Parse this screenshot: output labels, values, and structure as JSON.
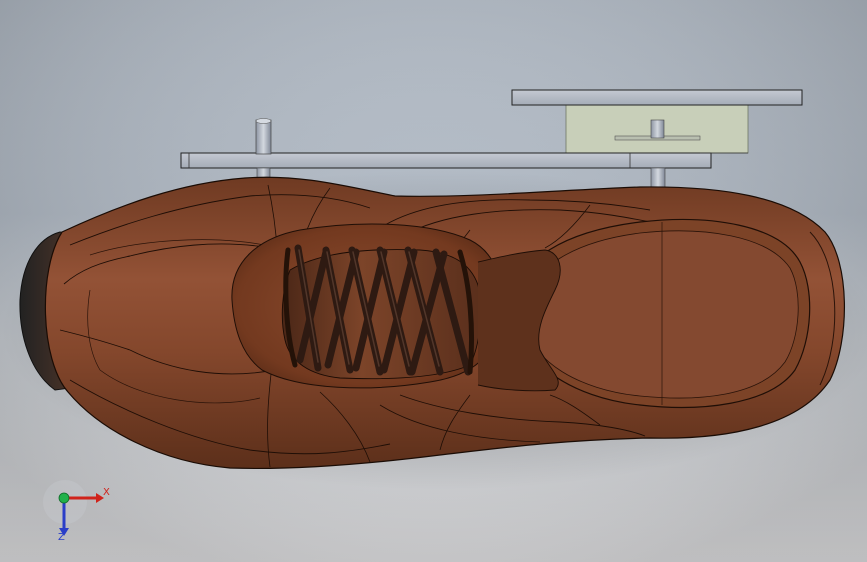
{
  "viewport": {
    "background_top": "#b7c0cb",
    "background_bottom": "#e8e8ea"
  },
  "model": {
    "shoe_color": "#7a4126",
    "shoe_highlight": "#9a5a3a",
    "lace_color": "#4a2e22",
    "sole_color": "#3a2a22",
    "fixture_plate_color": "#b6bcc6",
    "fixture_block_color": "#c6cdb9"
  },
  "triad": {
    "x_label": "X",
    "z_label": "Z",
    "x_color": "#d0231b",
    "y_color": "#21b14a",
    "z_color": "#2a3ec8",
    "icon": "coordinate-triad-icon"
  }
}
